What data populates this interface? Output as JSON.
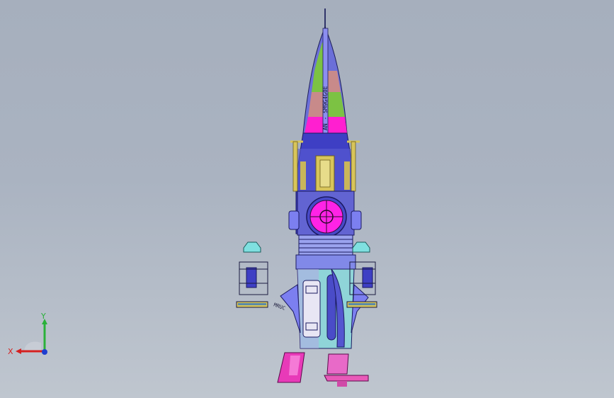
{
  "viewport": {
    "background_top": "#a6afbd",
    "background_bottom": "#bfc6cf"
  },
  "model": {
    "nose_label": "AN - SM9G4G0E",
    "side_label": "MRUC",
    "colors": {
      "body": "#6b6fd8",
      "body_dark": "#2d2ea8",
      "nose_green": "#7cc243",
      "nose_pink": "#c88a8a",
      "nose_magenta": "#ff1fd0",
      "porthole": "#ff23e6",
      "gold": "#d8c55a",
      "cyan": "#7fe0e0",
      "fins": "#7c7ff0",
      "nozzle": "#e83ab8"
    }
  },
  "triad": {
    "x_label": "X",
    "y_label": "Y",
    "x_color": "#d42020",
    "y_color": "#2ab13a",
    "z_color": "#1e3ecf"
  }
}
